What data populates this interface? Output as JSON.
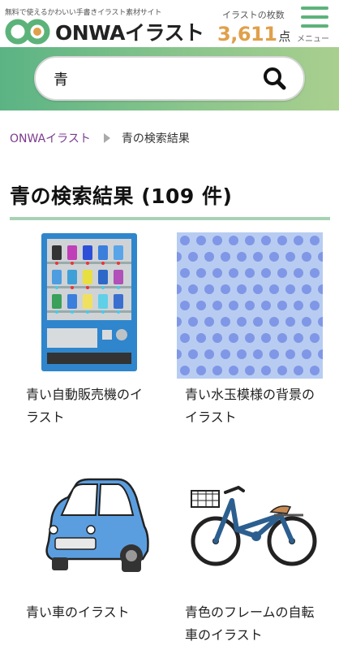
{
  "header": {
    "tagline": "無料で使えるかわいい手書きイラスト素材サイト",
    "logo_text": "ONWAイラスト",
    "count_label": "イラストの枚数",
    "count_value": "3,611",
    "count_unit": "点",
    "menu_label": "メニュー"
  },
  "search": {
    "value": "青"
  },
  "breadcrumb": {
    "home": "ONWAイラスト",
    "current": "青の検索結果"
  },
  "results": {
    "title": "青の検索結果 (109 件)",
    "items": [
      {
        "caption": "青い自動販売機のイラスト",
        "icon": "vending-machine"
      },
      {
        "caption": "青い水玉模様の背景のイラスト",
        "icon": "polka-dot-pattern"
      },
      {
        "caption": "青い車のイラスト",
        "icon": "blue-car"
      },
      {
        "caption": "青色のフレームの自転車のイラスト",
        "icon": "blue-bicycle"
      }
    ]
  },
  "colors": {
    "brand_green": "#5cb37a",
    "count_orange": "#e0a04a",
    "link_purple": "#7a3b8c"
  }
}
